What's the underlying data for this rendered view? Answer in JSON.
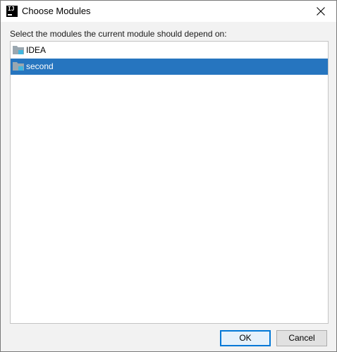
{
  "window": {
    "title": "Choose Modules",
    "app_icon": "intellij-idea-icon",
    "close_icon": "close-icon"
  },
  "prompt": "Select the modules the current module should depend on:",
  "modules": [
    {
      "label": "IDEA",
      "icon": "module-folder-icon",
      "selected": false
    },
    {
      "label": "second",
      "icon": "module-folder-icon",
      "selected": true
    }
  ],
  "buttons": {
    "ok": "OK",
    "cancel": "Cancel"
  },
  "colors": {
    "selection": "#2675bf",
    "folder_gray": "#9aa7b0",
    "folder_accent": "#40b6e0"
  }
}
